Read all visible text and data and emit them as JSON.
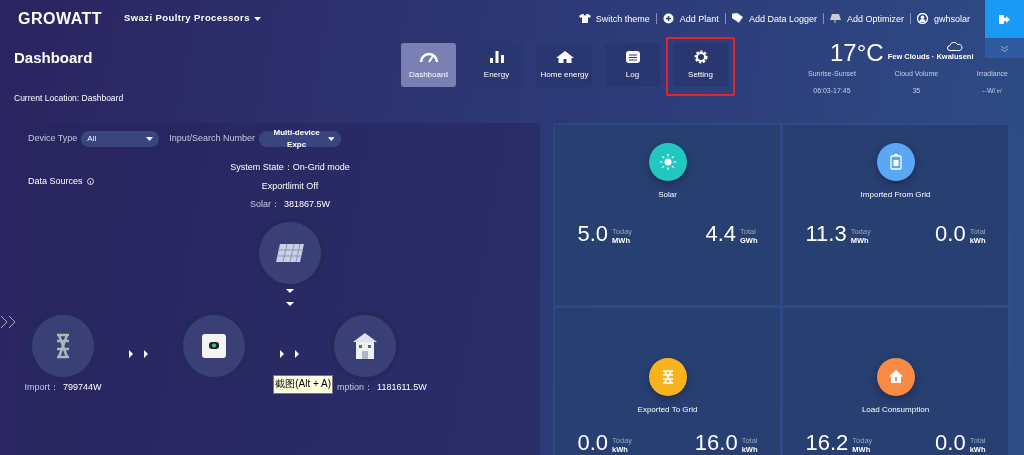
{
  "brand": "GROWATT",
  "plant_selector": {
    "label": "Swazi Poultry Processors"
  },
  "top_links": [
    {
      "kind": "theme",
      "label": "Switch theme"
    },
    {
      "kind": "plant",
      "label": "Add Plant"
    },
    {
      "kind": "logger",
      "label": "Add Data Logger"
    },
    {
      "kind": "optimizer",
      "label": "Add Optimizer"
    },
    {
      "kind": "user",
      "label": "gwhsolar"
    }
  ],
  "page": {
    "title": "Dashboard",
    "location": "Current Location: Dashboard"
  },
  "nav_tabs": [
    {
      "kind": "gauge",
      "label": "Dashboard",
      "selected": true,
      "highlighted": false
    },
    {
      "kind": "bars",
      "label": "Energy",
      "selected": false,
      "highlighted": false
    },
    {
      "kind": "home",
      "label": "Home energy",
      "selected": false,
      "highlighted": false
    },
    {
      "kind": "log",
      "label": "Log",
      "selected": false,
      "highlighted": false
    },
    {
      "kind": "gear",
      "label": "Setting",
      "selected": false,
      "highlighted": true
    }
  ],
  "weather": {
    "temperature": "17°C",
    "condition": "Few Clouds · Kwaluseni",
    "stats": [
      {
        "label": "Sunrise-Sunset",
        "value": "06:03-17:45"
      },
      {
        "label": "Cloud Volume",
        "value": "35"
      },
      {
        "label": "Irradiance",
        "value": "--W/㎡"
      }
    ]
  },
  "filters": [
    {
      "label": "Device Type",
      "value": "All"
    },
    {
      "label": "Input/Search Number",
      "value": "Multi-device Expc"
    }
  ],
  "flow": {
    "data_sources": "Data Sources",
    "system_state": "System State：On-Grid mode",
    "export_limit": "Exportlimit Off",
    "solar": {
      "label": "Solar：",
      "value": "381867.5W"
    },
    "import": {
      "label": "Import：",
      "value": "799744W"
    },
    "consumption": {
      "label": "mption：",
      "value": "1181611.5W"
    }
  },
  "tooltip": "截图(Alt + A)",
  "stat_cards": [
    {
      "kind": "solar",
      "title": "Solar",
      "color": "#22c7c0",
      "today": "5.0",
      "today_label": "Today",
      "today_unit": "MWh",
      "total": "4.4",
      "total_label": "Total",
      "total_unit": "GWh"
    },
    {
      "kind": "battery",
      "title": "Imported From Grid",
      "color": "#5aa8f5",
      "today": "11.3",
      "today_label": "Today",
      "today_unit": "MWh",
      "total": "0.0",
      "total_label": "Total",
      "total_unit": "kWh"
    },
    {
      "kind": "tower",
      "title": "Exported To Grid",
      "color": "#f7b21d",
      "today": "0.0",
      "today_label": "Today",
      "today_unit": "kWh",
      "total": "16.0",
      "total_label": "Total",
      "total_unit": "kWh"
    },
    {
      "kind": "house",
      "title": "Load Consumption",
      "color": "#f88a45",
      "today": "16.2",
      "today_label": "Today",
      "today_unit": "MWh",
      "total": "0.0",
      "total_label": "Total",
      "total_unit": "kWh"
    }
  ]
}
